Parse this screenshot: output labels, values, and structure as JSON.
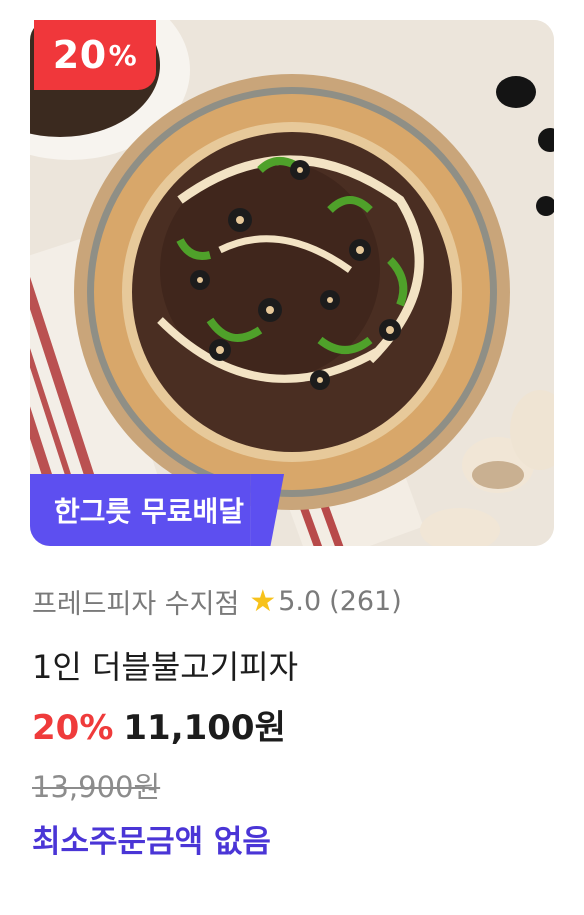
{
  "product_card": {
    "image_alt": "더블불고기피자",
    "discount_badge": {
      "value": "20",
      "suffix": "%",
      "color": "#f0373b"
    },
    "delivery_tag": {
      "label": "한그릇 무료배달",
      "color": "#5d4ff0"
    },
    "store_name": "프레드피자 수지점",
    "rating_icon": "star-icon",
    "rating": "5.0",
    "review_count": "(261)",
    "menu_name": "1인 더블불고기피자",
    "discount_rate": "20%",
    "sale_price": "11,100원",
    "original_price": "13,900원",
    "min_order_text": "최소주문금액 없음",
    "accent_color": "#4a35d6"
  }
}
